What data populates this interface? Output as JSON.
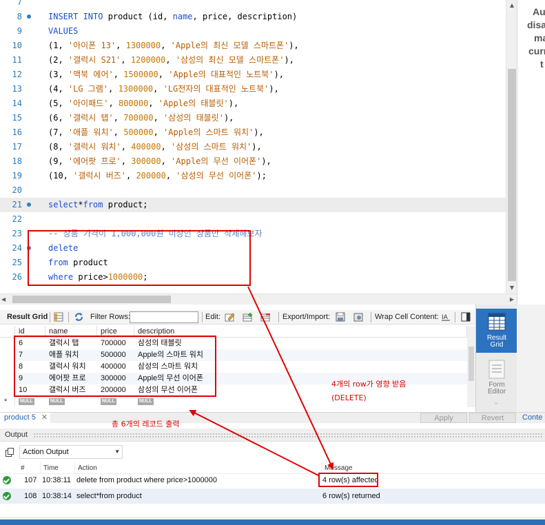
{
  "editor": {
    "lines": [
      {
        "n": "7",
        "dot": false,
        "tokens": []
      },
      {
        "n": "8",
        "dot": true,
        "tokens": [
          {
            "t": "INSERT INTO ",
            "c": "kw"
          },
          {
            "t": "product (id, ",
            "c": "plain"
          },
          {
            "t": "name",
            "c": "kw"
          },
          {
            "t": ", price, description)",
            "c": "plain"
          }
        ]
      },
      {
        "n": "9",
        "dot": false,
        "tokens": [
          {
            "t": "VALUES",
            "c": "kw"
          }
        ]
      },
      {
        "n": "10",
        "dot": false,
        "tokens": [
          {
            "t": "(1, ",
            "c": "plain"
          },
          {
            "t": "'아이폰 13'",
            "c": "str"
          },
          {
            "t": ", ",
            "c": "plain"
          },
          {
            "t": "1300000",
            "c": "num"
          },
          {
            "t": ", ",
            "c": "plain"
          },
          {
            "t": "'Apple의 최신 모델 스마트폰'",
            "c": "str"
          },
          {
            "t": "),",
            "c": "plain"
          }
        ]
      },
      {
        "n": "11",
        "dot": false,
        "tokens": [
          {
            "t": "(2, ",
            "c": "plain"
          },
          {
            "t": "'갤럭시 S21'",
            "c": "str"
          },
          {
            "t": ", ",
            "c": "plain"
          },
          {
            "t": "1200000",
            "c": "num"
          },
          {
            "t": ", ",
            "c": "plain"
          },
          {
            "t": "'삼성의 최신 모델 스마트폰'",
            "c": "str"
          },
          {
            "t": "),",
            "c": "plain"
          }
        ]
      },
      {
        "n": "12",
        "dot": false,
        "tokens": [
          {
            "t": "(3, ",
            "c": "plain"
          },
          {
            "t": "'맥북 에어'",
            "c": "str"
          },
          {
            "t": ", ",
            "c": "plain"
          },
          {
            "t": "1500000",
            "c": "num"
          },
          {
            "t": ", ",
            "c": "plain"
          },
          {
            "t": "'Apple의 대표적인 노트북'",
            "c": "str"
          },
          {
            "t": "),",
            "c": "plain"
          }
        ]
      },
      {
        "n": "13",
        "dot": false,
        "tokens": [
          {
            "t": "(4, ",
            "c": "plain"
          },
          {
            "t": "'LG 그램'",
            "c": "str"
          },
          {
            "t": ", ",
            "c": "plain"
          },
          {
            "t": "1300000",
            "c": "num"
          },
          {
            "t": ", ",
            "c": "plain"
          },
          {
            "t": "'LG전자의 대표적인 노트북'",
            "c": "str"
          },
          {
            "t": "),",
            "c": "plain"
          }
        ]
      },
      {
        "n": "14",
        "dot": false,
        "tokens": [
          {
            "t": "(5, ",
            "c": "plain"
          },
          {
            "t": "'아이패드'",
            "c": "str"
          },
          {
            "t": ", ",
            "c": "plain"
          },
          {
            "t": "800000",
            "c": "num"
          },
          {
            "t": ", ",
            "c": "plain"
          },
          {
            "t": "'Apple의 태블릿'",
            "c": "str"
          },
          {
            "t": "),",
            "c": "plain"
          }
        ]
      },
      {
        "n": "15",
        "dot": false,
        "tokens": [
          {
            "t": "(6, ",
            "c": "plain"
          },
          {
            "t": "'갤럭시 탭'",
            "c": "str"
          },
          {
            "t": ", ",
            "c": "plain"
          },
          {
            "t": "700000",
            "c": "num"
          },
          {
            "t": ", ",
            "c": "plain"
          },
          {
            "t": "'삼성의 태블릿'",
            "c": "str"
          },
          {
            "t": "),",
            "c": "plain"
          }
        ]
      },
      {
        "n": "16",
        "dot": false,
        "tokens": [
          {
            "t": "(7, ",
            "c": "plain"
          },
          {
            "t": "'애플 워치'",
            "c": "str"
          },
          {
            "t": ", ",
            "c": "plain"
          },
          {
            "t": "500000",
            "c": "num"
          },
          {
            "t": ", ",
            "c": "plain"
          },
          {
            "t": "'Apple의 스마트 워치'",
            "c": "str"
          },
          {
            "t": "),",
            "c": "plain"
          }
        ]
      },
      {
        "n": "17",
        "dot": false,
        "tokens": [
          {
            "t": "(8, ",
            "c": "plain"
          },
          {
            "t": "'갤럭시 워치'",
            "c": "str"
          },
          {
            "t": ", ",
            "c": "plain"
          },
          {
            "t": "400000",
            "c": "num"
          },
          {
            "t": ", ",
            "c": "plain"
          },
          {
            "t": "'삼성의 스마트 워치'",
            "c": "str"
          },
          {
            "t": "),",
            "c": "plain"
          }
        ]
      },
      {
        "n": "18",
        "dot": false,
        "tokens": [
          {
            "t": "(9, ",
            "c": "plain"
          },
          {
            "t": "'에어팟 프로'",
            "c": "str"
          },
          {
            "t": ", ",
            "c": "plain"
          },
          {
            "t": "300000",
            "c": "num"
          },
          {
            "t": ", ",
            "c": "plain"
          },
          {
            "t": "'Apple의 무선 이어폰'",
            "c": "str"
          },
          {
            "t": "),",
            "c": "plain"
          }
        ]
      },
      {
        "n": "19",
        "dot": false,
        "tokens": [
          {
            "t": "(10, ",
            "c": "plain"
          },
          {
            "t": "'갤럭시 버즈'",
            "c": "str"
          },
          {
            "t": ", ",
            "c": "plain"
          },
          {
            "t": "200000",
            "c": "num"
          },
          {
            "t": ", ",
            "c": "plain"
          },
          {
            "t": "'삼성의 무선 이어폰'",
            "c": "str"
          },
          {
            "t": ");",
            "c": "plain"
          }
        ]
      },
      {
        "n": "20",
        "dot": false,
        "tokens": []
      },
      {
        "n": "21",
        "dot": true,
        "current": true,
        "tokens": [
          {
            "t": "select",
            "c": "kw"
          },
          {
            "t": "*",
            "c": "plain"
          },
          {
            "t": "from",
            "c": "kw"
          },
          {
            "t": " product;",
            "c": "plain"
          }
        ]
      },
      {
        "n": "22",
        "dot": false,
        "tokens": []
      },
      {
        "n": "23",
        "dot": false,
        "tokens": [
          {
            "t": "-- 상품 가격이 1,000,000원 이상인 상품만 삭제해보자",
            "c": "cmt"
          }
        ]
      },
      {
        "n": "24",
        "dot": true,
        "tokens": [
          {
            "t": "delete",
            "c": "kw"
          }
        ]
      },
      {
        "n": "25",
        "dot": false,
        "tokens": [
          {
            "t": "from",
            "c": "kw"
          },
          {
            "t": " product",
            "c": "plain"
          }
        ]
      },
      {
        "n": "26",
        "dot": false,
        "tokens": [
          {
            "t": "where",
            "c": "kw"
          },
          {
            "t": " price>",
            "c": "plain"
          },
          {
            "t": "1000000",
            "c": "num"
          },
          {
            "t": ";",
            "c": "plain"
          }
        ]
      }
    ]
  },
  "help_panel": {
    "lines": [
      "Au",
      "disa",
      "ma",
      "curr",
      "t"
    ]
  },
  "result_toolbar": {
    "result_grid_label": "Result Grid",
    "filter_rows_label": "Filter Rows:",
    "filter_value": "",
    "edit_label": "Edit:",
    "export_label": "Export/Import:",
    "wrap_label": "Wrap Cell Content:"
  },
  "grid": {
    "columns": [
      "id",
      "name",
      "price",
      "description"
    ],
    "rows": [
      [
        "6",
        "갤럭시 탭",
        "700000",
        "삼성의 태블릿"
      ],
      [
        "7",
        "애플 워치",
        "500000",
        "Apple의 스마트 워치"
      ],
      [
        "8",
        "갤럭시 워치",
        "400000",
        "삼성의 스마트 워치"
      ],
      [
        "9",
        "에어팟 프로",
        "300000",
        "Apple의 무선 이어폰"
      ],
      [
        "10",
        "갤럭시 버즈",
        "200000",
        "삼성의 무선 이어폰"
      ]
    ],
    "new_row_marker": "*",
    "null_badge": "NULL"
  },
  "side_panel": {
    "result_grid": "Result\nGrid",
    "form_editor": "Form\nEditor"
  },
  "tabs": {
    "result_tab": "product 5",
    "close": "✕",
    "apply": "Apply",
    "revert": "Revert",
    "context": "Conte"
  },
  "output": {
    "title": "Output",
    "selector": "Action Output",
    "columns": [
      "#",
      "Time",
      "Action",
      "Message"
    ],
    "rows": [
      {
        "num": "107",
        "time": "10:38:11",
        "action": "delete  from product where price>1000000",
        "message": "4 row(s) affected"
      },
      {
        "num": "108",
        "time": "10:38:14",
        "action": "select*from product",
        "message": "6 row(s) returned"
      }
    ]
  },
  "annotations": {
    "delete_note_line1": "4개의 row가 영향 받음",
    "delete_note_line2": "(DELETE)",
    "records_note": "총 6개의 레코드 출력"
  },
  "colors": {
    "annotation": "#e00000",
    "keyword": "#1a4fd0",
    "string": "#b85c00",
    "number": "#c57500",
    "accent": "#2b72c0"
  }
}
